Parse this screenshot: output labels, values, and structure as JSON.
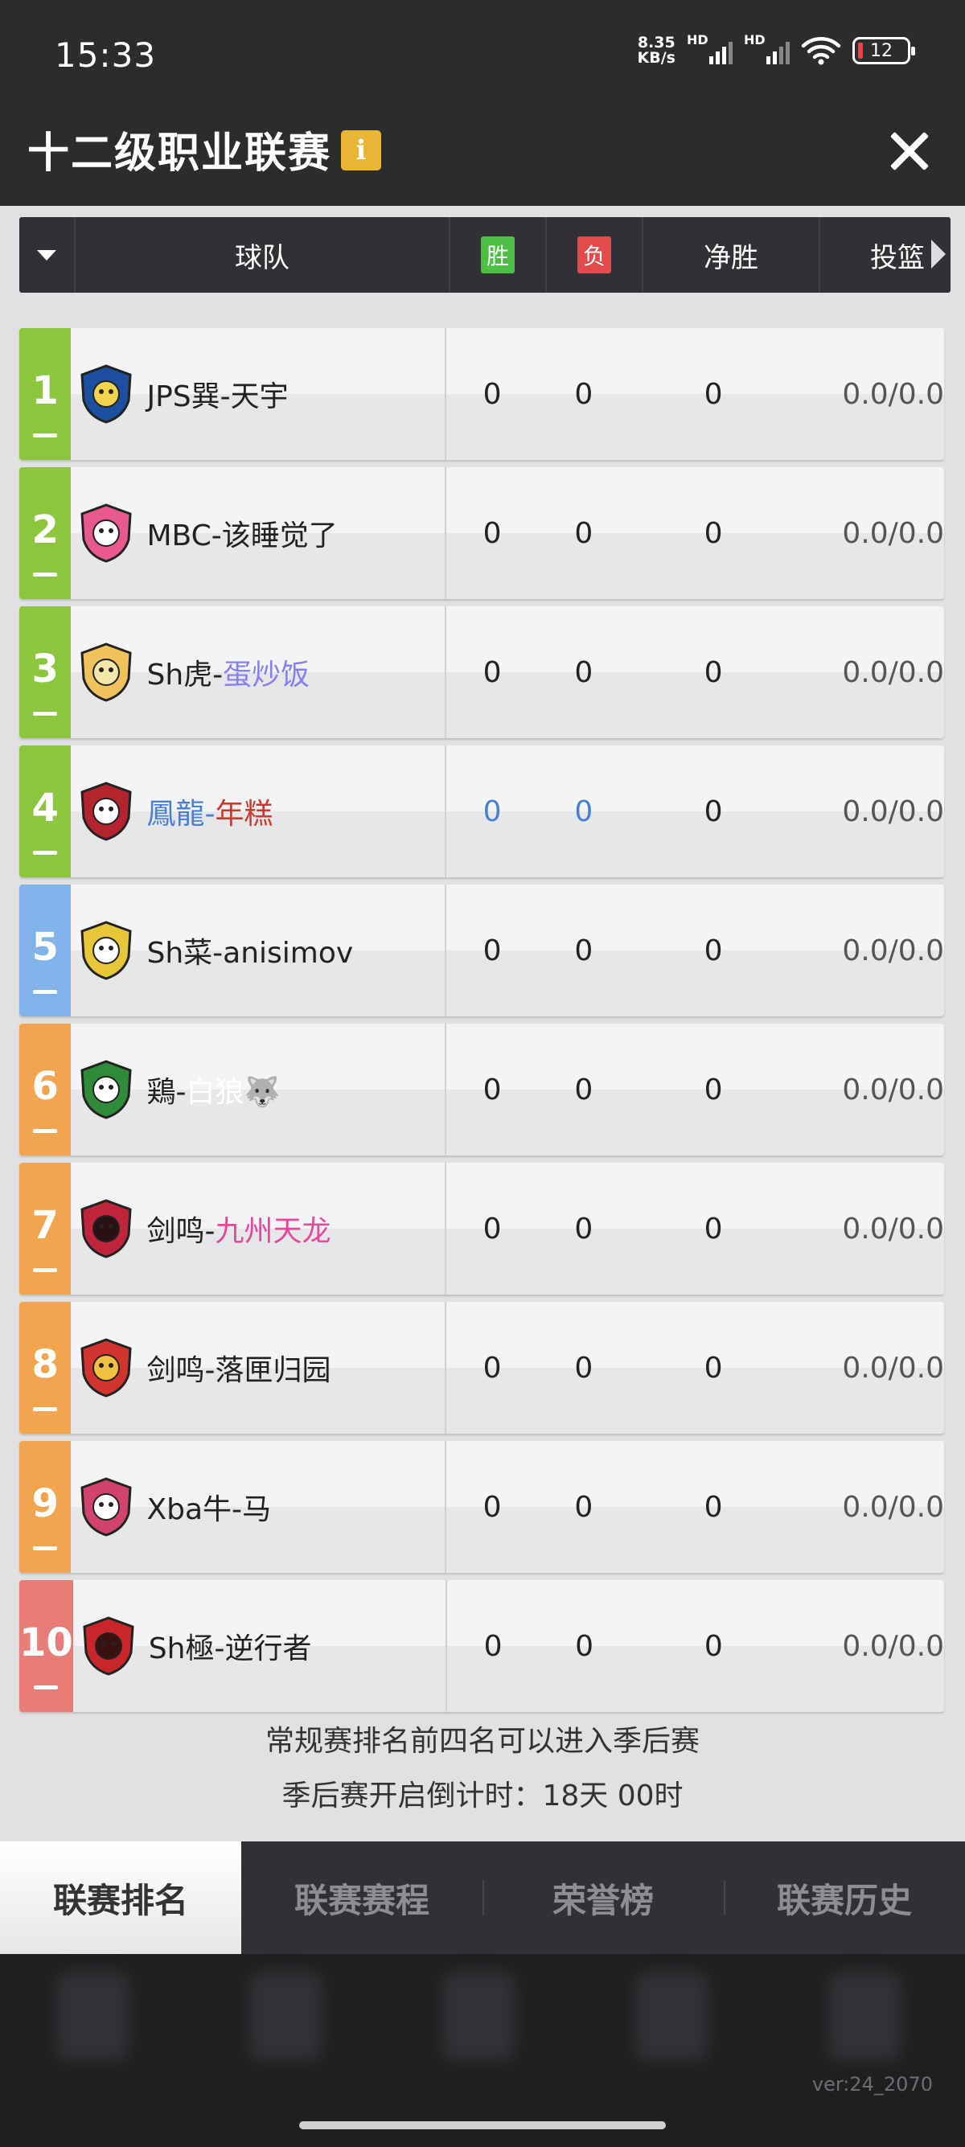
{
  "status_bar": {
    "time": "15:33",
    "net_speed_value": "8.35",
    "net_speed_unit": "KB/s",
    "sim1_label": "HD",
    "sim2_label": "HD",
    "battery": "12"
  },
  "title_bar": {
    "title": "十二级职业联赛",
    "info_label": "i"
  },
  "table_header": {
    "team": "球队",
    "win": "胜",
    "loss": "负",
    "net_win": "净胜",
    "shooting": "投篮"
  },
  "teams": [
    {
      "rank": "1",
      "prefix": "JPS巽-",
      "name": "天宇",
      "name_color": "#222222",
      "prefix_color": "#222222",
      "win": "0",
      "loss": "0",
      "net": "0",
      "shooting": "0.0/0.0",
      "rank_color": "green",
      "num_color": "normal"
    },
    {
      "rank": "2",
      "prefix": "MBC-",
      "name": "该睡觉了",
      "name_color": "#222222",
      "prefix_color": "#222222",
      "win": "0",
      "loss": "0",
      "net": "0",
      "shooting": "0.0/0.0",
      "rank_color": "green",
      "num_color": "normal"
    },
    {
      "rank": "3",
      "prefix": "Sh虎-",
      "name": "蛋炒饭",
      "name_color": "#8a7ef0",
      "prefix_color": "#222222",
      "win": "0",
      "loss": "0",
      "net": "0",
      "shooting": "0.0/0.0",
      "rank_color": "green",
      "num_color": "normal"
    },
    {
      "rank": "4",
      "prefix": "鳳龍-",
      "name": "年糕",
      "name_color": "#cc3b2e",
      "prefix_color": "#4a7fd1",
      "win": "0",
      "loss": "0",
      "net": "0",
      "shooting": "0.0/0.0",
      "rank_color": "green",
      "num_color": "blue"
    },
    {
      "rank": "5",
      "prefix": "Sh菜-",
      "name": "anisimov",
      "name_color": "#222222",
      "prefix_color": "#222222",
      "win": "0",
      "loss": "0",
      "net": "0",
      "shooting": "0.0/0.0",
      "rank_color": "blue",
      "num_color": "normal"
    },
    {
      "rank": "6",
      "prefix": "鶏-",
      "name": "白狼🐺",
      "name_color": "#ffffff",
      "prefix_color": "#222222",
      "win": "0",
      "loss": "0",
      "net": "0",
      "shooting": "0.0/0.0",
      "rank_color": "orange",
      "num_color": "normal"
    },
    {
      "rank": "7",
      "prefix": "剑鸣-",
      "name": "九州天龙",
      "name_color": "#e8479b",
      "prefix_color": "#222222",
      "win": "0",
      "loss": "0",
      "net": "0",
      "shooting": "0.0/0.0",
      "rank_color": "orange",
      "num_color": "normal"
    },
    {
      "rank": "8",
      "prefix": "剑鸣-",
      "name": "落匣归园",
      "name_color": "#222222",
      "prefix_color": "#222222",
      "win": "0",
      "loss": "0",
      "net": "0",
      "shooting": "0.0/0.0",
      "rank_color": "orange",
      "num_color": "normal"
    },
    {
      "rank": "9",
      "prefix": "Xba牛-",
      "name": "马",
      "name_color": "#222222",
      "prefix_color": "#222222",
      "win": "0",
      "loss": "0",
      "net": "0",
      "shooting": "0.0/0.0",
      "rank_color": "orange",
      "num_color": "normal"
    },
    {
      "rank": "10",
      "prefix": "Sh極-",
      "name": "逆行者",
      "name_color": "#222222",
      "prefix_color": "#222222",
      "win": "0",
      "loss": "0",
      "net": "0",
      "shooting": "0.0/0.0",
      "rank_color": "red",
      "num_color": "normal"
    }
  ],
  "notes": {
    "playoff_rule": "常规赛排名前四名可以进入季后赛",
    "countdown": "季后赛开启倒计时：18天 00时"
  },
  "tabs": [
    {
      "label": "联赛排名",
      "active": true
    },
    {
      "label": "联赛赛程",
      "active": false
    },
    {
      "label": "荣誉榜",
      "active": false
    },
    {
      "label": "联赛历史",
      "active": false
    }
  ],
  "version": "ver:24_2070"
}
